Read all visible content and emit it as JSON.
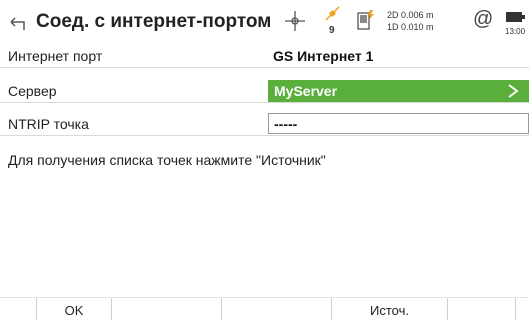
{
  "header": {
    "title": "Соед. с интернет-портом",
    "satellites": "9",
    "precision_2d": "2D 0.006 m",
    "precision_1d": "1D 0.010 m",
    "at_symbol": "@",
    "time": "13:00"
  },
  "form": {
    "internet_port": {
      "label": "Интернет порт",
      "value": "GS Интернет 1"
    },
    "server": {
      "label": "Сервер",
      "value": "MyServer",
      "chevron": ">"
    },
    "ntrip": {
      "label": "NTRIP точка",
      "value": "-----"
    }
  },
  "info_text": "Для получения списка точек нажмите \"Источник\"",
  "softkeys": {
    "ok": "OK",
    "source": "Источ."
  },
  "colors": {
    "accent": "#5aae3c",
    "gps_orange": "#f0a020"
  }
}
